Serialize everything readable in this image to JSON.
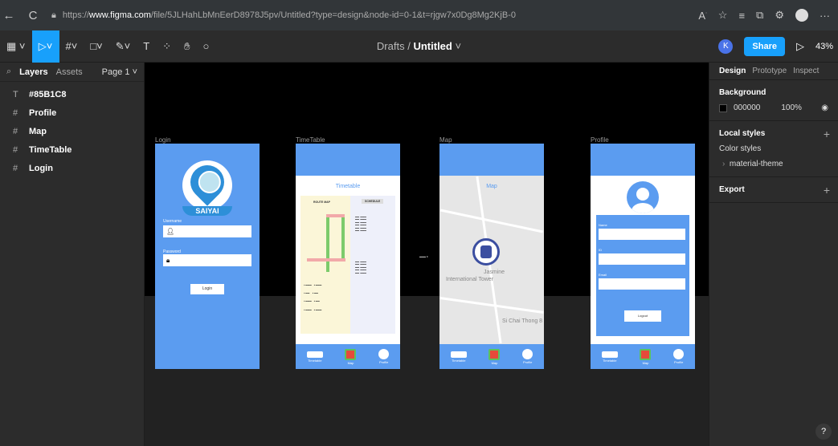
{
  "browser": {
    "url_prefix": "https://",
    "url_domain": "www.figma.com",
    "url_path": "/file/5JLHahLbMnEerD8978J5pv/Untitled?type=design&node-id=0-1&t=rjgw7x0Dg8Mg2KjB-0"
  },
  "toolbar": {
    "breadcrumb_root": "Drafts",
    "separator": "/",
    "file_name": "Untitled",
    "user_initial": "K",
    "share_label": "Share",
    "zoom": "43%"
  },
  "left_panel": {
    "tabs": [
      "Layers",
      "Assets"
    ],
    "page": "Page 1",
    "layers": [
      {
        "glyph": "T",
        "name": "#85B1C8"
      },
      {
        "glyph": "#",
        "name": "Profile"
      },
      {
        "glyph": "#",
        "name": "Map"
      },
      {
        "glyph": "#",
        "name": "TimeTable"
      },
      {
        "glyph": "#",
        "name": "Login"
      }
    ]
  },
  "right_panel": {
    "tabs": [
      "Design",
      "Prototype",
      "Inspect"
    ],
    "background_title": "Background",
    "background_hex": "000000",
    "background_opacity": "100%",
    "local_styles_title": "Local styles",
    "color_styles_label": "Color styles",
    "style_item": "material-theme",
    "export_title": "Export",
    "help": "?"
  },
  "frames": {
    "login": {
      "label": "Login",
      "logo_text": "SAIYAI",
      "username_label": "Username",
      "password_label": "Password",
      "login_button": "Login"
    },
    "timetable": {
      "label": "TimeTable",
      "title": "Timetable",
      "route_map": "ROUTE MAP",
      "schedule": "SCHEDULE"
    },
    "map": {
      "label": "Map",
      "title": "Map",
      "place1": "Jasmine",
      "place2": "International Tower",
      "road": "Si Chai Thong 8"
    },
    "profile": {
      "label": "Profile",
      "name_label": "Name",
      "id_label": "ID",
      "email_label": "Email",
      "logout_button": "Logout"
    },
    "nav": [
      "Timetable",
      "Map",
      "Profile"
    ]
  },
  "colors": {
    "accent": "#18a0fb",
    "frame_blue": "#5b9cf0"
  }
}
